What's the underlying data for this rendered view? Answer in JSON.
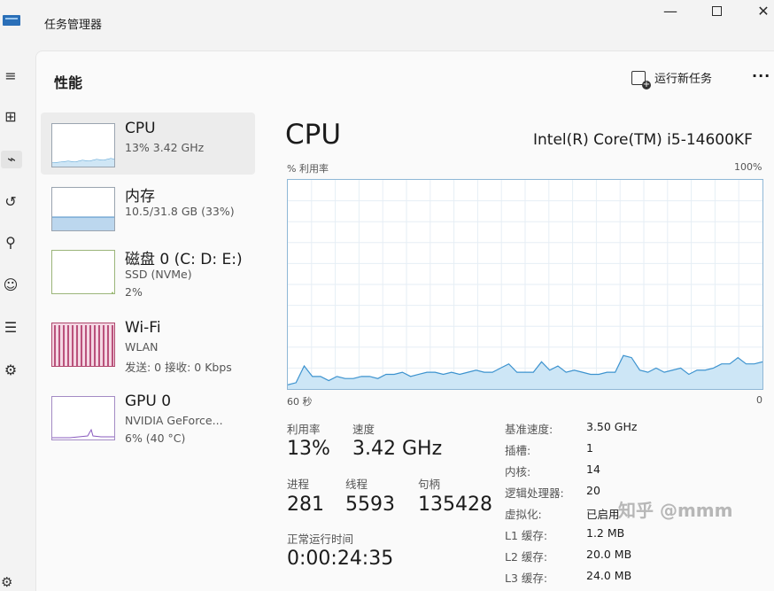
{
  "window": {
    "title": "任务管理器",
    "minimize": "—",
    "close": "✕"
  },
  "rail": {
    "items": [
      {
        "icon": "hamburger-icon",
        "glyph": "≡"
      },
      {
        "icon": "processes-icon",
        "glyph": "⊞"
      },
      {
        "icon": "performance-icon",
        "glyph": "⌁"
      },
      {
        "icon": "app-history-icon",
        "glyph": "↺"
      },
      {
        "icon": "startup-apps-icon",
        "glyph": "⚲"
      },
      {
        "icon": "users-icon",
        "glyph": "☺"
      },
      {
        "icon": "details-icon",
        "glyph": "☰"
      },
      {
        "icon": "services-icon",
        "glyph": "⚙"
      }
    ],
    "settings_glyph": "⚙"
  },
  "header": {
    "title": "性能",
    "run_task_label": "运行新任务",
    "more_label": "···"
  },
  "devices": [
    {
      "name": "CPU",
      "sub1": "13% 3.42 GHz",
      "sub2": ""
    },
    {
      "name": "内存",
      "sub1": "10.5/31.8 GB (33%)",
      "sub2": ""
    },
    {
      "name": "磁盘 0 (C: D: E:)",
      "sub1": "SSD (NVMe)",
      "sub2": "2%"
    },
    {
      "name": "Wi-Fi",
      "sub1": "WLAN",
      "sub2": "发送: 0 接收: 0 Kbps"
    },
    {
      "name": "GPU 0",
      "sub1": "NVIDIA GeForce...",
      "sub2": "6% (40 °C)"
    }
  ],
  "cpu": {
    "title": "CPU",
    "model": "Intel(R) Core(TM) i5-14600KF",
    "util_label": "% 利用率",
    "util_max": "100%",
    "time_left": "60 秒",
    "time_right": "0",
    "graph_values": [
      2,
      3,
      11,
      6,
      6,
      4,
      6,
      5,
      5,
      6,
      6,
      5,
      7,
      7,
      8,
      6,
      7,
      8,
      8,
      7,
      8,
      7,
      8,
      9,
      8,
      8,
      10,
      12,
      8,
      8,
      8,
      13,
      9,
      11,
      8,
      9,
      8,
      7,
      7,
      8,
      8,
      16,
      15,
      9,
      8,
      10,
      8,
      9,
      10,
      7,
      9,
      9,
      10,
      12,
      12,
      15,
      12,
      12,
      13
    ]
  },
  "stats": {
    "util_label": "利用率",
    "util_value": "13%",
    "speed_label": "速度",
    "speed_value": "3.42 GHz",
    "proc_label": "进程",
    "proc_value": "281",
    "thread_label": "线程",
    "thread_value": "5593",
    "handle_label": "句柄",
    "handle_value": "135428",
    "uptime_label": "正常运行时间",
    "uptime_value": "0:00:24:35"
  },
  "specs": [
    {
      "key": "基准速度:",
      "value": "3.50 GHz"
    },
    {
      "key": "插槽:",
      "value": "1"
    },
    {
      "key": "内核:",
      "value": "14"
    },
    {
      "key": "逻辑处理器:",
      "value": "20"
    },
    {
      "key": "虚拟化:",
      "value": "已启用"
    },
    {
      "key": "L1 缓存:",
      "value": "1.2 MB"
    },
    {
      "key": "L2 缓存:",
      "value": "20.0 MB"
    },
    {
      "key": "L3 缓存:",
      "value": "24.0 MB"
    }
  ],
  "watermark": "知乎 @mmm"
}
